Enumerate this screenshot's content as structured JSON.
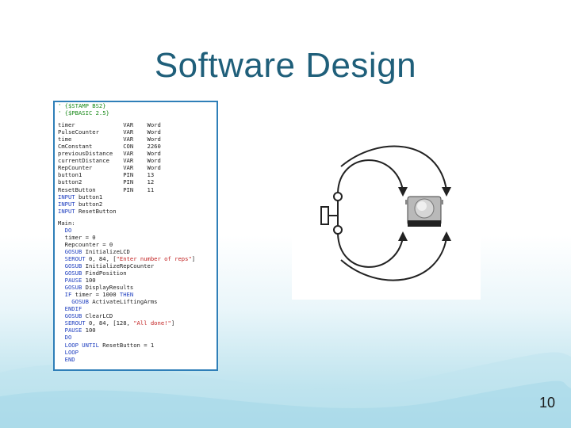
{
  "slide": {
    "title": "Software Design",
    "page_number": "10"
  },
  "code": [
    [
      [
        "comment",
        "' {$STAMP BS2}"
      ]
    ],
    [
      [
        "comment",
        "' {$PBASIC 2.5}"
      ]
    ],
    [],
    [
      [
        "txt",
        "timer              VAR    Word"
      ]
    ],
    [
      [
        "txt",
        "PulseCounter       VAR    Word"
      ]
    ],
    [
      [
        "txt",
        "time               VAR    Word"
      ]
    ],
    [
      [
        "txt",
        "CmConstant         CON    2260"
      ]
    ],
    [
      [
        "txt",
        "previousDistance   VAR    Word"
      ]
    ],
    [
      [
        "txt",
        "currentDistance    VAR    Word"
      ]
    ],
    [
      [
        "txt",
        "RepCounter         VAR    Word"
      ]
    ],
    [
      [
        "txt",
        "button1            PIN    13"
      ]
    ],
    [
      [
        "txt",
        "button2            PIN    12"
      ]
    ],
    [
      [
        "txt",
        "ResetButton        PIN    11"
      ]
    ],
    [
      [
        "kw",
        "INPUT"
      ],
      [
        "txt",
        " button1"
      ]
    ],
    [
      [
        "kw",
        "INPUT"
      ],
      [
        "txt",
        " button2"
      ]
    ],
    [
      [
        "kw",
        "INPUT"
      ],
      [
        "txt",
        " ResetButton"
      ]
    ],
    [],
    [
      [
        "txt",
        "Main:"
      ]
    ],
    [
      [
        "kw",
        "  DO"
      ]
    ],
    [
      [
        "txt",
        "  timer = 0"
      ]
    ],
    [
      [
        "txt",
        "  Repcounter = 0"
      ]
    ],
    [
      [
        "kw",
        "  GOSUB"
      ],
      [
        "txt",
        " InitializeLCD"
      ]
    ],
    [
      [
        "kw",
        "  SEROUT"
      ],
      [
        "txt",
        " 0, 84, ["
      ],
      [
        "str",
        "\"Enter number of reps\""
      ],
      [
        "txt",
        "]"
      ]
    ],
    [
      [
        "kw",
        "  GOSUB"
      ],
      [
        "txt",
        " InitializeRepCounter"
      ]
    ],
    [
      [
        "kw",
        "  GOSUB"
      ],
      [
        "txt",
        " FindPosition"
      ]
    ],
    [
      [
        "kw",
        "  PAUSE"
      ],
      [
        "txt",
        " 100"
      ]
    ],
    [
      [
        "kw",
        "  GOSUB"
      ],
      [
        "txt",
        " DisplayResults"
      ]
    ],
    [
      [
        "kw",
        "  IF"
      ],
      [
        "txt",
        " timer = 1000 "
      ],
      [
        "kw",
        "THEN"
      ]
    ],
    [
      [
        "kw",
        "    GOSUB"
      ],
      [
        "txt",
        " ActivateLiftingArms"
      ]
    ],
    [
      [
        "kw",
        "  ENDIF"
      ]
    ],
    [
      [
        "kw",
        "  GOSUB"
      ],
      [
        "txt",
        " ClearLCD"
      ]
    ],
    [
      [
        "kw",
        "  SEROUT"
      ],
      [
        "txt",
        " 0, 84, [128, "
      ],
      [
        "str",
        "\"All done!\""
      ],
      [
        "txt",
        "]"
      ]
    ],
    [
      [
        "kw",
        "  PAUSE"
      ],
      [
        "txt",
        " 100"
      ]
    ],
    [
      [
        "kw",
        "  DO"
      ]
    ],
    [
      [
        "kw",
        "  LOOP UNTIL"
      ],
      [
        "txt",
        " ResetButton = 1"
      ]
    ],
    [
      [
        "kw",
        "  LOOP"
      ]
    ],
    [
      [
        "kw",
        "  END"
      ]
    ]
  ],
  "colors": {
    "title": "#1f5f7a",
    "panel_border": "#2f7fb8",
    "comment": "#1a8a1a",
    "keyword": "#1f3fbf",
    "string": "#c22222"
  },
  "figure": {
    "icon": "pushbutton-switch-diagram"
  }
}
